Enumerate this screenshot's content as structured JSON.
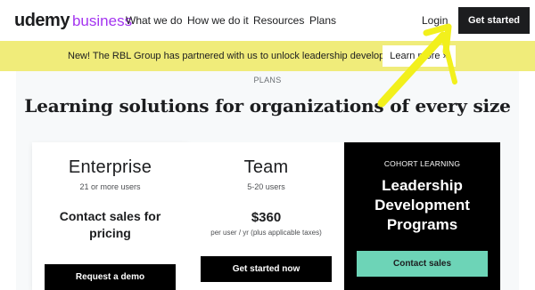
{
  "nav": {
    "logo_main": "udemy",
    "logo_sub": "business",
    "links": [
      "What we do",
      "How we do it",
      "Resources",
      "Plans"
    ],
    "login": "Login",
    "cta": "Get started"
  },
  "banner": {
    "text": "New! The RBL Group has partnered with us to unlock leadership development.",
    "button": "Learn more »"
  },
  "hero": {
    "eyebrow": "PLANS",
    "headline": "Learning solutions for organizations of every size"
  },
  "cards": {
    "enterprise": {
      "title": "Enterprise",
      "sub": "21 or more users",
      "pricing": "Contact sales for pricing",
      "button": "Request a demo"
    },
    "team": {
      "title": "Team",
      "sub": "5-20 users",
      "price": "$360",
      "price_note": "per user / yr (plus applicable taxes)",
      "button": "Get started now"
    },
    "cohort": {
      "eyebrow": "COHORT LEARNING",
      "title": "Leadership Development Programs",
      "button": "Contact sales"
    }
  },
  "colors": {
    "brand_purple": "#a435f0",
    "banner_yellow": "#f0ec7a",
    "cohort_button": "#6dd4b7",
    "annotation_yellow": "#f2f01c"
  }
}
